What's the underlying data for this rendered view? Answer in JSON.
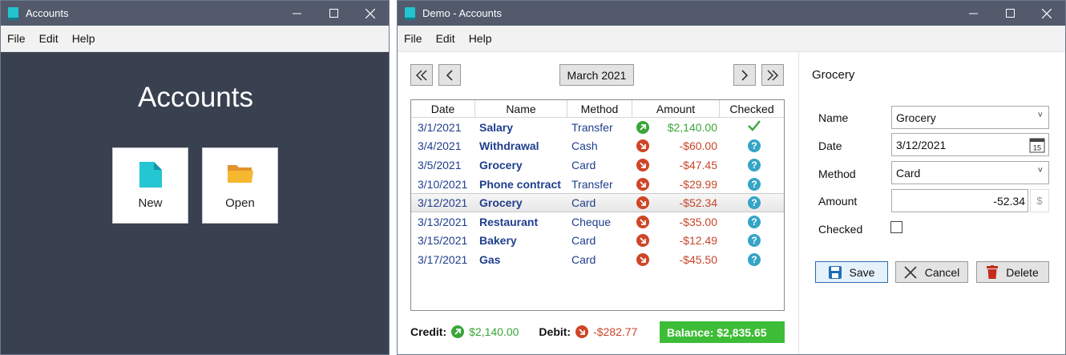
{
  "left_window": {
    "title": "Accounts",
    "menu": [
      "File",
      "Edit",
      "Help"
    ],
    "heading": "Accounts",
    "tiles": [
      {
        "label": "New",
        "icon": "new-file-icon"
      },
      {
        "label": "Open",
        "icon": "open-folder-icon"
      }
    ]
  },
  "right_window": {
    "title": "Demo - Accounts",
    "menu": [
      "File",
      "Edit",
      "Help"
    ],
    "period": "March 2021",
    "grid": {
      "columns": [
        "Date",
        "Name",
        "Method",
        "Amount",
        "Checked"
      ],
      "rows": [
        {
          "date": "3/1/2021",
          "name": "Salary",
          "method": "Transfer",
          "direction": "credit",
          "amount": "$2,140.00",
          "checked": true
        },
        {
          "date": "3/4/2021",
          "name": "Withdrawal",
          "method": "Cash",
          "direction": "debit",
          "amount": "-$60.00",
          "checked": false
        },
        {
          "date": "3/5/2021",
          "name": "Grocery",
          "method": "Card",
          "direction": "debit",
          "amount": "-$47.45",
          "checked": false
        },
        {
          "date": "3/10/2021",
          "name": "Phone contract",
          "method": "Transfer",
          "direction": "debit",
          "amount": "-$29.99",
          "checked": false
        },
        {
          "date": "3/12/2021",
          "name": "Grocery",
          "method": "Card",
          "direction": "debit",
          "amount": "-$52.34",
          "checked": false,
          "selected": true
        },
        {
          "date": "3/13/2021",
          "name": "Restaurant",
          "method": "Cheque",
          "direction": "debit",
          "amount": "-$35.00",
          "checked": false
        },
        {
          "date": "3/15/2021",
          "name": "Bakery",
          "method": "Card",
          "direction": "debit",
          "amount": "-$12.49",
          "checked": false
        },
        {
          "date": "3/17/2021",
          "name": "Gas",
          "method": "Card",
          "direction": "debit",
          "amount": "-$45.50",
          "checked": false
        }
      ]
    },
    "totals": {
      "credit_label": "Credit:",
      "credit_value": "$2,140.00",
      "debit_label": "Debit:",
      "debit_value": "-$282.77",
      "balance": "Balance: $2,835.65"
    },
    "detail": {
      "title": "Grocery",
      "labels": {
        "name": "Name",
        "date": "Date",
        "method": "Method",
        "amount": "Amount",
        "checked": "Checked"
      },
      "name_value": "Grocery",
      "date_value": "3/12/2021",
      "method_value": "Card",
      "amount_value": "-52.34",
      "currency_symbol": "$",
      "checked_value": false,
      "calendar_day": "15",
      "buttons": {
        "save": "Save",
        "cancel": "Cancel",
        "delete": "Delete"
      }
    }
  },
  "colors": {
    "titlebar": "#525a6c",
    "dark_panel": "#394150",
    "credit_green": "#3aa639",
    "debit_red": "#c8462a",
    "link_blue": "#1f3e8c",
    "balance_green": "#3dbd37"
  }
}
